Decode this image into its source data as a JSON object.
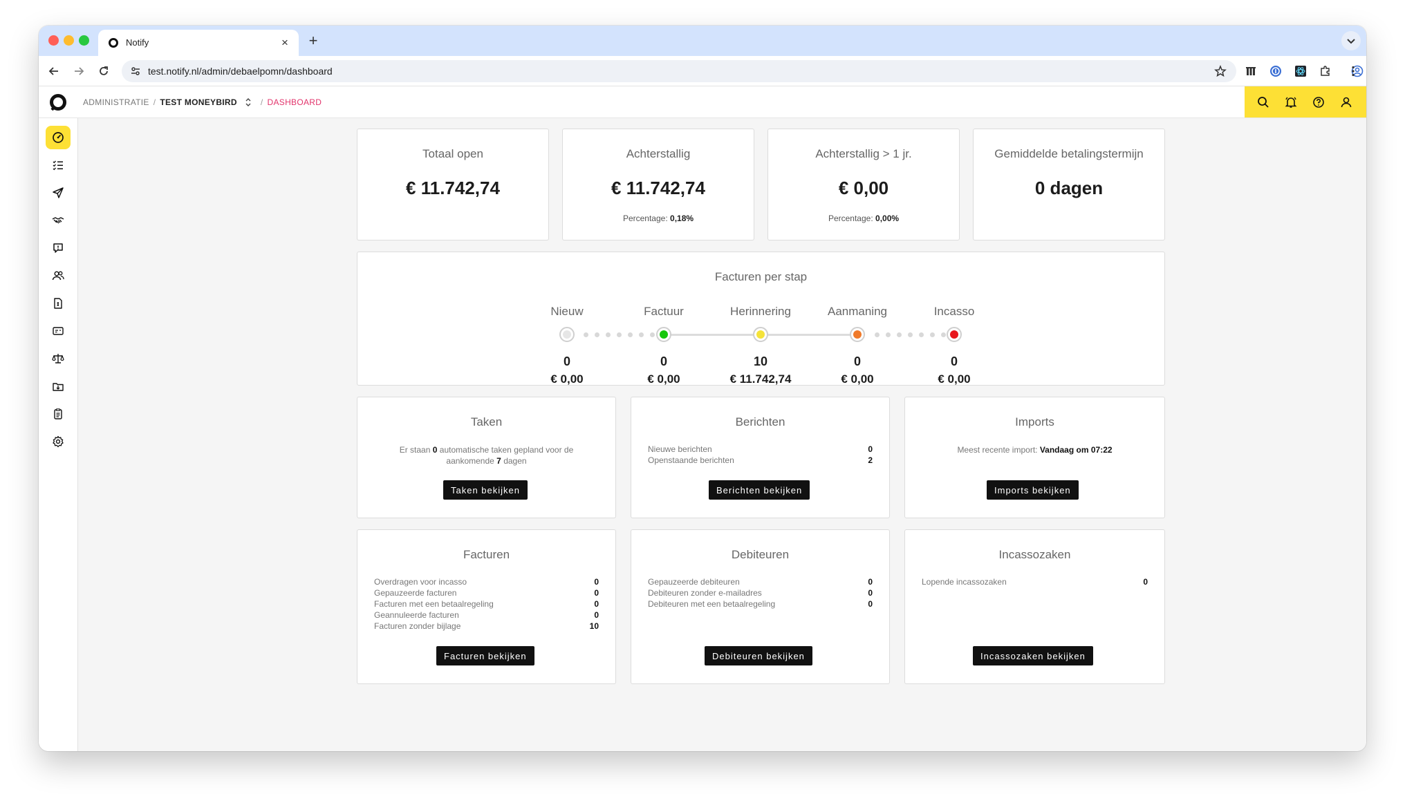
{
  "browser": {
    "tab_title": "Notify",
    "new_tab": "+",
    "close_tab": "×",
    "url": "test.notify.nl/admin/debaelpomn/dashboard"
  },
  "header": {
    "breadcrumb_admin": "ADMINISTRATIE",
    "breadcrumb_sep": "/",
    "breadcrumb_account": "TEST MONEYBIRD",
    "breadcrumb_current": "DASHBOARD",
    "accent_color": "#fde035",
    "current_color": "#e2336b"
  },
  "sidebar": {
    "icons": [
      "dashboard-icon",
      "tasks-icon",
      "send-icon",
      "handshake-icon",
      "message-icon",
      "users-icon",
      "invoice-icon",
      "id-card-icon",
      "scales-icon",
      "inbox-icon",
      "clipboard-icon",
      "gear-icon"
    ]
  },
  "stats": [
    {
      "label": "Totaal open",
      "value": "€ 11.742,74",
      "pct_label": "",
      "pct_value": ""
    },
    {
      "label": "Achterstallig",
      "value": "€ 11.742,74",
      "pct_label": "Percentage:",
      "pct_value": "0,18%"
    },
    {
      "label": "Achterstallig > 1 jr.",
      "value": "€ 0,00",
      "pct_label": "Percentage:",
      "pct_value": "0,00%"
    },
    {
      "label": "Gemiddelde betalingstermijn",
      "value": "0 dagen",
      "pct_label": "",
      "pct_value": ""
    }
  ],
  "pipeline": {
    "title": "Facturen per stap",
    "steps": [
      {
        "label": "Nieuw",
        "count": "0",
        "amount": "€ 0,00",
        "color": "#e6e6e6"
      },
      {
        "label": "Factuur",
        "count": "0",
        "amount": "€ 0,00",
        "color": "#16c60c"
      },
      {
        "label": "Herinnering",
        "count": "10",
        "amount": "€ 11.742,74",
        "color": "#f5e33a"
      },
      {
        "label": "Aanmaning",
        "count": "0",
        "amount": "€ 0,00",
        "color": "#f07a2a"
      },
      {
        "label": "Incasso",
        "count": "0",
        "amount": "€ 0,00",
        "color": "#e8151b"
      }
    ]
  },
  "taken": {
    "title": "Taken",
    "line1_a": "Er staan",
    "line1_num": "0",
    "line1_b": "automatische taken gepland voor de",
    "line2_a": "aankomende",
    "line2_num": "7",
    "line2_b": "dagen",
    "button": "Taken bekijken"
  },
  "berichten": {
    "title": "Berichten",
    "rows": [
      {
        "label": "Nieuwe berichten",
        "value": "0"
      },
      {
        "label": "Openstaande berichten",
        "value": "2"
      }
    ],
    "button": "Berichten bekijken"
  },
  "imports": {
    "title": "Imports",
    "recent_label": "Meest recente import:",
    "recent_value": "Vandaag om 07:22",
    "button": "Imports bekijken"
  },
  "facturen": {
    "title": "Facturen",
    "rows": [
      {
        "label": "Overdragen voor incasso",
        "value": "0"
      },
      {
        "label": "Gepauzeerde facturen",
        "value": "0"
      },
      {
        "label": "Facturen met een betaalregeling",
        "value": "0"
      },
      {
        "label": "Geannuleerde facturen",
        "value": "0"
      },
      {
        "label": "Facturen zonder bijlage",
        "value": "10"
      }
    ],
    "button": "Facturen bekijken"
  },
  "debiteuren": {
    "title": "Debiteuren",
    "rows": [
      {
        "label": "Gepauzeerde debiteuren",
        "value": "0"
      },
      {
        "label": "Debiteuren zonder e-mailadres",
        "value": "0"
      },
      {
        "label": "Debiteuren met een betaalregeling",
        "value": "0"
      }
    ],
    "button": "Debiteuren bekijken"
  },
  "incassozaken": {
    "title": "Incassozaken",
    "rows": [
      {
        "label": "Lopende incassozaken",
        "value": "0"
      }
    ],
    "button": "Incassozaken bekijken"
  }
}
